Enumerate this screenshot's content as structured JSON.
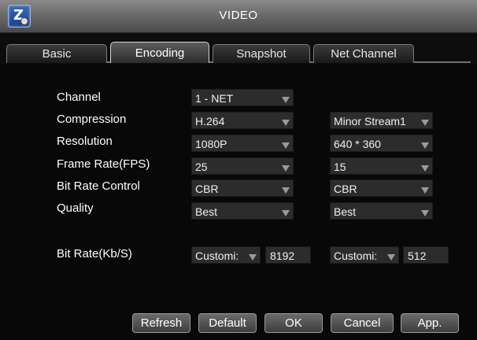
{
  "window": {
    "title": "VIDEO",
    "app_icon": "z-logo-icon"
  },
  "tabs": [
    {
      "label": "Basic",
      "active": false
    },
    {
      "label": "Encoding",
      "active": true
    },
    {
      "label": "Snapshot",
      "active": false
    },
    {
      "label": "Net Channel",
      "active": false
    }
  ],
  "form": {
    "channel": {
      "label": "Channel",
      "main": "1 - NET"
    },
    "compression": {
      "label": "Compression",
      "main": "H.264",
      "sub": "Minor Stream1"
    },
    "resolution": {
      "label": "Resolution",
      "main": "1080P",
      "sub": "640 * 360"
    },
    "frame_rate": {
      "label": "Frame Rate(FPS)",
      "main": "25",
      "sub": "15"
    },
    "bit_rate_control": {
      "label": "Bit Rate Control",
      "main": "CBR",
      "sub": "CBR"
    },
    "quality": {
      "label": "Quality",
      "main": "Best",
      "sub": "Best"
    },
    "bit_rate": {
      "label": "Bit Rate(Kb/S)",
      "main_mode": "Customi:",
      "main_value": "8192",
      "sub_mode": "Customi:",
      "sub_value": "512"
    }
  },
  "buttons": {
    "refresh": "Refresh",
    "default": "Default",
    "ok": "OK",
    "cancel": "Cancel",
    "apply": "App."
  }
}
